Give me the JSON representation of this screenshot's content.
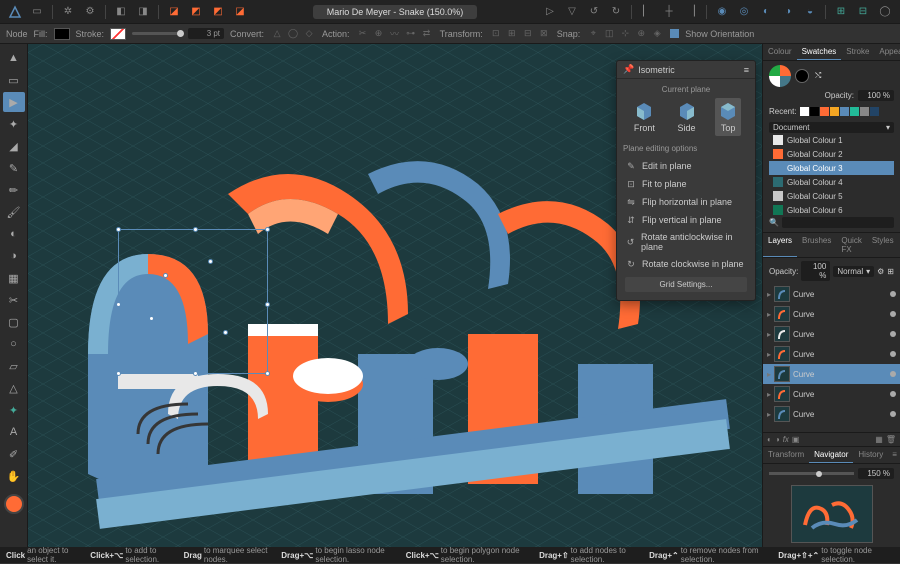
{
  "topbar": {
    "doc_title": "Mario De Meyer - Snake (150.0%)"
  },
  "context": {
    "node": "Node",
    "fill": "Fill:",
    "stroke": "Stroke:",
    "pt": "3 pt",
    "convert": "Convert:",
    "action": "Action:",
    "transform": "Transform:",
    "snap": "Snap:",
    "show_orientation": "Show Orientation"
  },
  "iso": {
    "title": "Isometric",
    "current_plane": "Current plane",
    "planes": [
      "Front",
      "Side",
      "Top"
    ],
    "editing_header": "Plane editing options",
    "opts": [
      "Edit in plane",
      "Fit to plane",
      "Flip horizontal in plane",
      "Flip vertical in plane",
      "Rotate anticlockwise in plane",
      "Rotate clockwise in plane"
    ],
    "grid_settings": "Grid Settings..."
  },
  "right": {
    "tabs1": [
      "Colour",
      "Swatches",
      "Stroke",
      "Appearance"
    ],
    "opacity_label": "Opacity:",
    "opacity_val": "100 %",
    "recent": "Recent:",
    "recent_colors": [
      "#fff",
      "#000",
      "#ff6b35",
      "#f5a623",
      "#5a8bb8",
      "#2b9",
      "#888",
      "#246"
    ],
    "doc_dd": "Document",
    "swatches": [
      "Global Colour 1",
      "Global Colour 2",
      "Global Colour 3",
      "Global Colour 4",
      "Global Colour 5",
      "Global Colour 6"
    ],
    "swatch_colors": [
      "#e8e8e8",
      "#ff6b35",
      "#5a8bb8",
      "#2c6b72",
      "#c8c8c8",
      "#175"
    ],
    "tabs2": [
      "Layers",
      "Brushes",
      "Quick FX",
      "Styles"
    ],
    "opacity2": "Opacity:",
    "opacity2_val": "100 %",
    "blend": "Normal",
    "layers": [
      "Curve",
      "Curve",
      "Curve",
      "Curve",
      "Curve",
      "Curve",
      "Curve"
    ],
    "layer_colors": [
      "#5a8bb8",
      "#ff6b35",
      "#e8e8e8",
      "#ff6b35",
      "#5a8bb8",
      "#ff6b35",
      "#5a8bb8"
    ],
    "tabs3": [
      "Transform",
      "Navigator",
      "History"
    ],
    "zoom": "150 %"
  },
  "status": {
    "s1": "Click",
    "t1": " an object to select it. ",
    "s2": "Click+⌥",
    "t2": " to add to selection. ",
    "s3": "Drag",
    "t3": " to marquee select nodes. ",
    "s4": "Drag+⌥",
    "t4": " to begin lasso node selection. ",
    "s5": "Click+⌥",
    "t5": " to begin polygon node selection. ",
    "s6": "Drag+⇧",
    "t6": " to add nodes to selection. ",
    "s7": "Drag+⌃",
    "t7": " to remove nodes from selection. ",
    "s8": "Drag+⇧+⌃",
    "t8": " to toggle node selection."
  }
}
